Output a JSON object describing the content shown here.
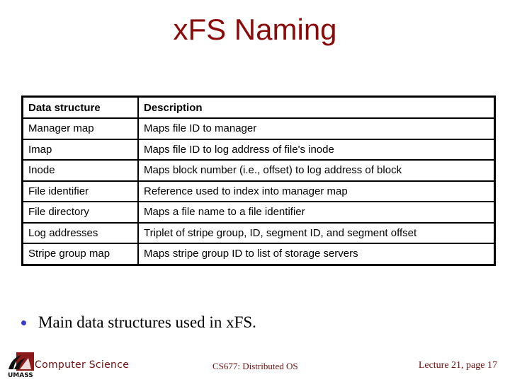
{
  "slide": {
    "title": "xFS Naming",
    "table": {
      "headers": [
        "Data structure",
        "Description"
      ],
      "rows": [
        [
          "Manager map",
          "Maps file ID to manager"
        ],
        [
          "Imap",
          "Maps file ID to log address of file's inode"
        ],
        [
          "Inode",
          "Maps block number (i.e., offset) to log address of block"
        ],
        [
          "File identifier",
          "Reference used to index into manager map"
        ],
        [
          "File directory",
          "Maps a file name to a file identifier"
        ],
        [
          "Log addresses",
          "Triplet of stripe group, ID, segment ID, and segment offset"
        ],
        [
          "Stripe group map",
          "Maps stripe group ID to list of storage servers"
        ]
      ]
    },
    "bullets": [
      "Main data structures used in xFS."
    ]
  },
  "footer": {
    "logo_text": "UMASS",
    "department": "Computer Science",
    "course": "CS677: Distributed OS",
    "page": "Lecture 21, page 17"
  },
  "colors": {
    "title": "#8b0a0a",
    "footer_text": "#6b0f0f",
    "bullet": "#3a3acc",
    "logo_maroon": "#8b1a1a"
  }
}
